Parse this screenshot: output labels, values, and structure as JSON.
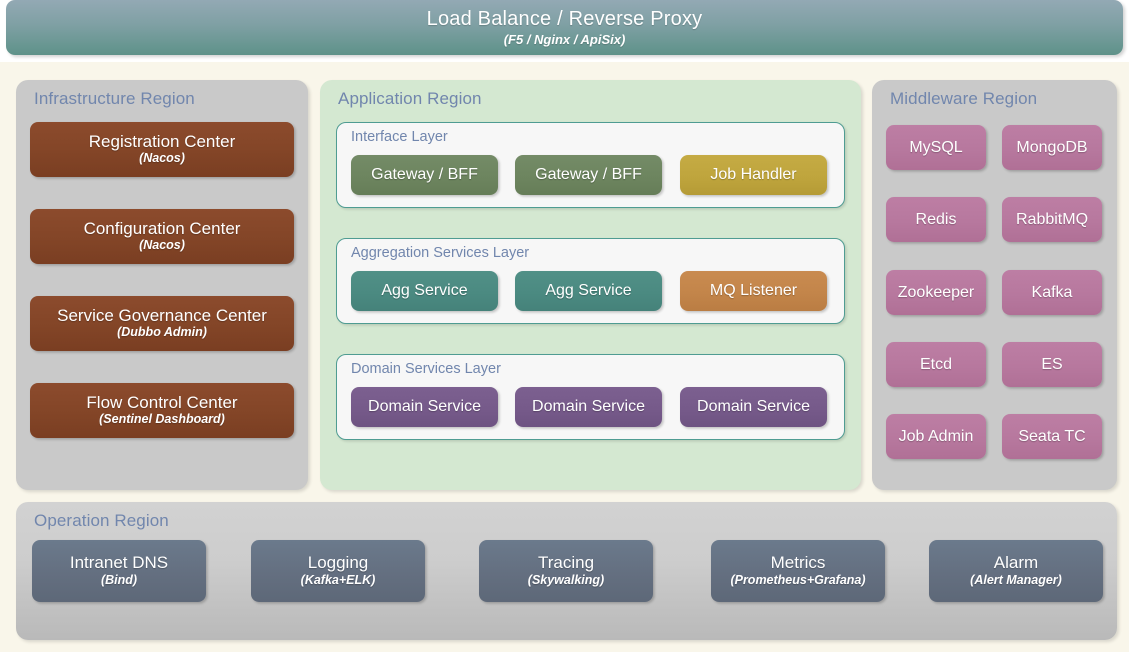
{
  "banner": {
    "title": "Load Balance / Reverse Proxy",
    "subtitle": "(F5 / Nginx / ApiSix)"
  },
  "colors": {
    "page_background": "#f9f6ea",
    "region_gray": "#c9c9c9",
    "region_green": "#d4e8d1",
    "region_title": "#7186ad",
    "infra_node": "#834527",
    "olive": "#6d855f",
    "gold": "#bfa53d",
    "teal": "#4b8a81",
    "orange": "#c3854a",
    "purple": "#765a8a",
    "pink": "#b7789e",
    "slate": "#646f80",
    "layer_border": "#4f9c92",
    "layer_fill": "#f7f7f7"
  },
  "infrastructure_region": {
    "title": "Infrastructure Region",
    "nodes": [
      {
        "title": "Registration Center",
        "subtitle": "(Nacos)"
      },
      {
        "title": "Configuration Center",
        "subtitle": "(Nacos)"
      },
      {
        "title": "Service Governance Center",
        "subtitle": "(Dubbo Admin)"
      },
      {
        "title": "Flow Control Center",
        "subtitle": "(Sentinel Dashboard)"
      }
    ]
  },
  "application_region": {
    "title": "Application Region",
    "layers": [
      {
        "title": "Interface Layer",
        "nodes": [
          {
            "label": "Gateway / BFF",
            "color": "olive"
          },
          {
            "label": "Gateway / BFF",
            "color": "olive"
          },
          {
            "label": "Job Handler",
            "color": "gold"
          }
        ]
      },
      {
        "title": "Aggregation Services Layer",
        "nodes": [
          {
            "label": "Agg Service",
            "color": "teal"
          },
          {
            "label": "Agg Service",
            "color": "teal"
          },
          {
            "label": "MQ Listener",
            "color": "orange"
          }
        ]
      },
      {
        "title": "Domain Services Layer",
        "nodes": [
          {
            "label": "Domain Service",
            "color": "purple"
          },
          {
            "label": "Domain Service",
            "color": "purple"
          },
          {
            "label": "Domain Service",
            "color": "purple"
          }
        ]
      }
    ]
  },
  "middleware_region": {
    "title": "Middleware Region",
    "nodes": [
      {
        "label": "MySQL"
      },
      {
        "label": "MongoDB"
      },
      {
        "label": "Redis"
      },
      {
        "label": "RabbitMQ"
      },
      {
        "label": "Zookeeper"
      },
      {
        "label": "Kafka"
      },
      {
        "label": "Etcd"
      },
      {
        "label": "ES"
      },
      {
        "label": "Job Admin"
      },
      {
        "label": "Seata TC"
      }
    ]
  },
  "operation_region": {
    "title": "Operation Region",
    "nodes": [
      {
        "title": "Intranet DNS",
        "subtitle": "(Bind)"
      },
      {
        "title": "Logging",
        "subtitle": "(Kafka+ELK)"
      },
      {
        "title": "Tracing",
        "subtitle": "(Skywalking)"
      },
      {
        "title": "Metrics",
        "subtitle": "(Prometheus+Grafana)"
      },
      {
        "title": "Alarm",
        "subtitle": "(Alert Manager)"
      }
    ]
  }
}
